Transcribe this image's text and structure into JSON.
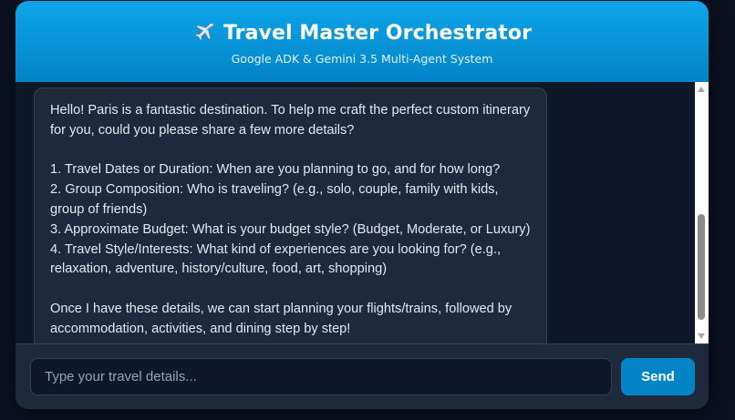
{
  "header": {
    "icon": "airplane-icon",
    "title": "Travel Master Orchestrator",
    "subtitle": "Google ADK & Gemini 3.5 Multi-Agent System"
  },
  "chat": {
    "messages": [
      {
        "role": "assistant",
        "lines": [
          "Hello! Paris is a fantastic destination. To help me craft the perfect custom itinerary for you, could you please share a few more details?",
          "",
          "1. Travel Dates or Duration: When are you planning to go, and for how long?",
          "2. Group Composition: Who is traveling? (e.g., solo, couple, family with kids, group of friends)",
          "3. Approximate Budget: What is your budget style? (Budget, Moderate, or Luxury)",
          "4. Travel Style/Interests: What kind of experiences are you looking for? (e.g., relaxation, adventure, history/culture, food, art, shopping)",
          "",
          "Once I have these details, we can start planning your flights/trains, followed by accommodation, activities, and dining step by step!"
        ]
      }
    ]
  },
  "input": {
    "placeholder": "Type your travel details...",
    "value": ""
  },
  "send_button": {
    "label": "Send"
  },
  "colors": {
    "accent": "#0284c7",
    "header_gradient_top": "#0ea5e9",
    "panel": "#1e293b",
    "background": "#0f172a"
  }
}
